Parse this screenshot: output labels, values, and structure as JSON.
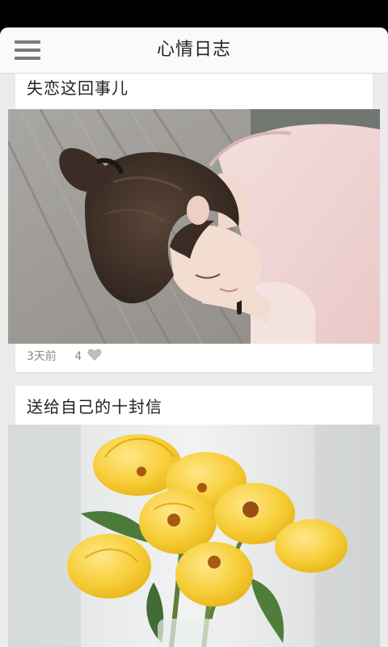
{
  "header": {
    "title": "心情日志",
    "menu_icon": "hamburger-menu-icon"
  },
  "posts": [
    {
      "title": "失恋这回事儿",
      "image": "girl-resting-head-photo",
      "time_ago": "3天前",
      "likes": "4",
      "like_icon": "heart-icon"
    },
    {
      "title": "送给自己的十封信",
      "image": "yellow-tulips-photo"
    }
  ],
  "colors": {
    "app_background": "#ebebeb",
    "header_background": "#fafafa",
    "card_background": "#ffffff",
    "meta_text": "#8a8a8a"
  }
}
